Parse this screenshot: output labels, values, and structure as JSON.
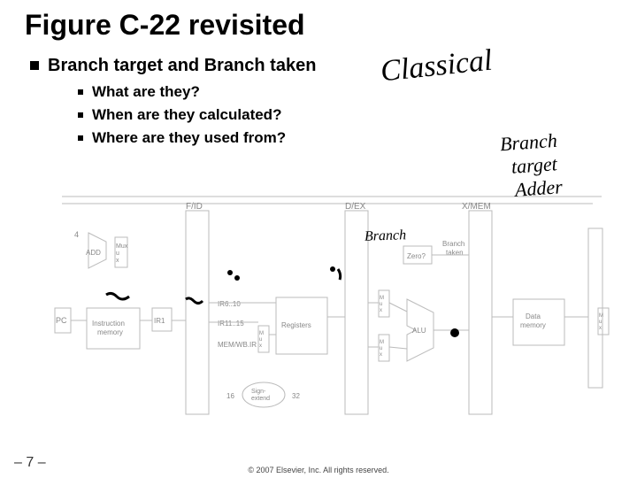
{
  "title": "Figure C-22 revisited",
  "main_bullet": "Branch target and Branch taken",
  "sub_bullets": [
    "What are they?",
    "When are they calculated?",
    "Where are they used from?"
  ],
  "page_label": "– 7 –",
  "copyright": "© 2007 Elsevier, Inc. All rights reserved.",
  "diagram": {
    "stage_labels": [
      "F/ID",
      "D/EX",
      "X/MEM"
    ],
    "small_labels": {
      "add_four": "4",
      "add": "ADD",
      "mux": "Mux",
      "pc": "PC",
      "instr_mem": "Instruction\nmemory",
      "ir1": "IR1",
      "ir6_10": "IR6..10",
      "ir11_15": "IR11..15",
      "mem_wb_ir": "MEM/WB.IR",
      "registers": "Registers",
      "sign_extend": "Sign-\nextend",
      "sixteen": "16",
      "thirtytwo": "32",
      "branch_taken": "Branch\ntaken",
      "zero": "Zero?",
      "alu": "ALU",
      "data_mem": "Data\nmemory"
    }
  },
  "handwriting": {
    "classical": "Classical",
    "branch_target_addr_line1": "Branch",
    "branch_target_addr_line2": "target",
    "branch_target_addr_line3": "Adder",
    "small_annot": "Branch"
  }
}
